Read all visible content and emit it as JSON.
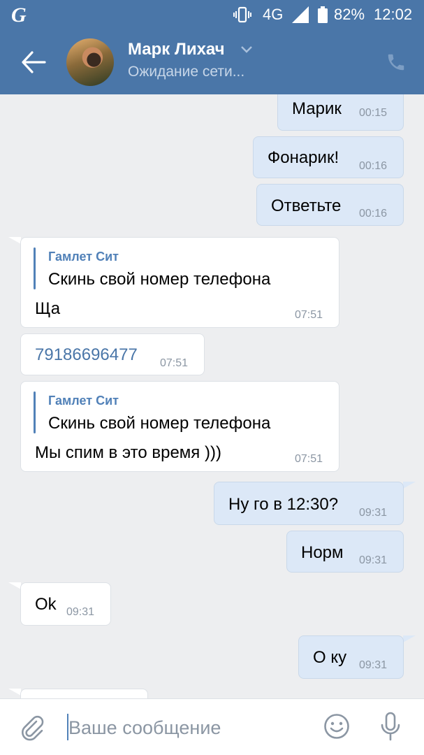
{
  "status_bar": {
    "logo": "G",
    "network": "4G",
    "battery": "82%",
    "time": "12:02",
    "icons": [
      "vibrate-icon",
      "signal-icon",
      "battery-icon"
    ]
  },
  "header": {
    "name": "Марк Лихач",
    "status": "Ожидание сети...",
    "icons": [
      "back-arrow-icon",
      "chevron-down-icon",
      "phone-icon"
    ]
  },
  "messages": [
    {
      "dir": "out",
      "text": "Марик",
      "time": "00:15"
    },
    {
      "dir": "out",
      "text": "Фонарик!",
      "time": "00:16"
    },
    {
      "dir": "out",
      "text": "Ответьте",
      "time": "00:16"
    },
    {
      "dir": "in",
      "quote_author": "Гамлет Сит",
      "quote_text": "Скинь свой номер телефона",
      "text": "Ща",
      "time": "07:51"
    },
    {
      "dir": "in",
      "text": "79186696477",
      "time": "07:51",
      "is_link": true
    },
    {
      "dir": "in",
      "quote_author": "Гамлет Сит",
      "quote_text": "Скинь свой номер телефона",
      "text": "Мы спим в это время )))",
      "time": "07:51"
    },
    {
      "dir": "out",
      "text": "Ну го в 12:30?",
      "time": "09:31"
    },
    {
      "dir": "out",
      "text": "Норм",
      "time": "09:31"
    },
    {
      "dir": "in",
      "text": "Ok",
      "time": "09:31"
    },
    {
      "dir": "out",
      "text": "О ку",
      "time": "09:31"
    }
  ],
  "input": {
    "placeholder": "Ваше сообщение",
    "icons": [
      "paperclip-icon",
      "emoji-icon",
      "microphone-icon"
    ]
  },
  "colors": {
    "header": "#4a76a8",
    "background": "#edeef0",
    "outgoing_bubble": "#dce8f7",
    "incoming_bubble": "#ffffff",
    "accent": "#5181b8",
    "timestamp": "#8b96a3"
  }
}
